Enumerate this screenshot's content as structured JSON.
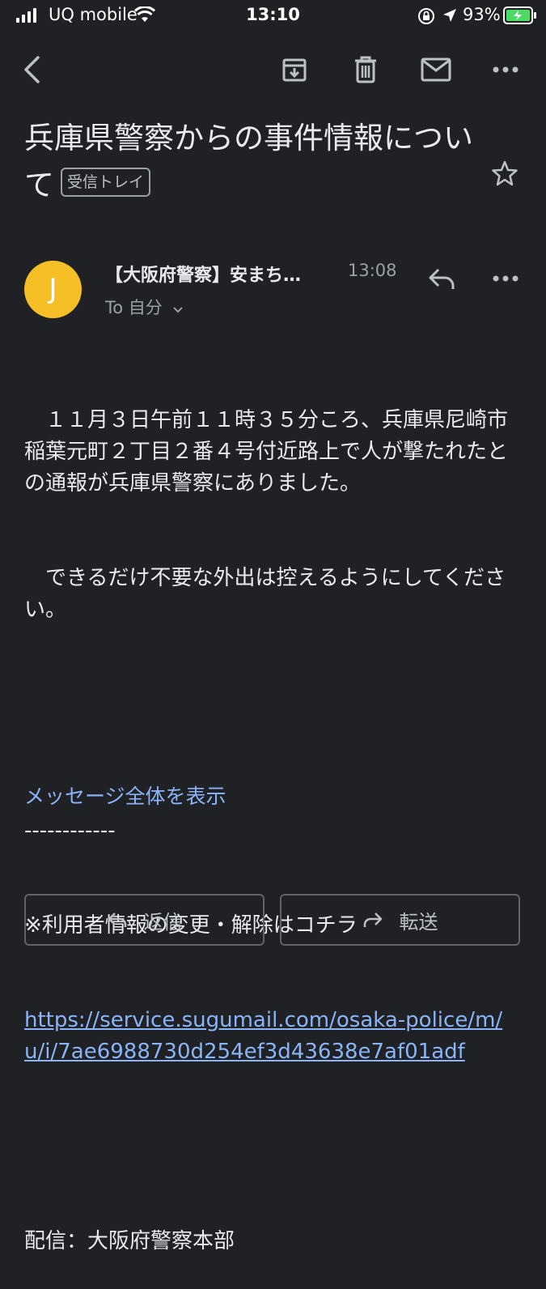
{
  "status_bar": {
    "carrier": "UQ mobile",
    "time": "13:10",
    "battery": "93%"
  },
  "toolbar": {
    "icons": [
      "back-arrow-icon",
      "archive-icon",
      "trash-icon",
      "mail-icon",
      "more-horizontal-icon"
    ]
  },
  "email": {
    "subject": "兵庫県警察からの事件情報について",
    "label": "受信トレイ",
    "sender_initial": "J",
    "sender": "【大阪府警察】安まち…",
    "time": "13:08",
    "to": "To 自分",
    "body_para1": "　１１月３日午前１１時３５分ころ、兵庫県尼崎市稲葉元町２丁目２番４号付近路上で人が撃たれたとの通報が兵庫県警察にありました。",
    "body_para2": "　できるだけ不要な外出は控えるようにしてください。",
    "separator": "------------",
    "notice": "※利用者情報の変更・解除はコチラ",
    "link": "https://service.sugumail.com/osaka-police/m/u/i/7ae6988730d254ef3d43638e7af01adf",
    "footer": "配信：大阪府警察本部",
    "show_all": "メッセージ全体を表示"
  },
  "actions": {
    "reply": "返信",
    "forward": "転送"
  },
  "colors": {
    "background": "#202124",
    "link": "#8ab4f8",
    "avatar": "#f6bf26"
  }
}
